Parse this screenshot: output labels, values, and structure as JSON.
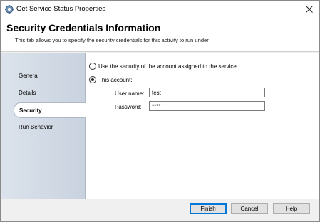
{
  "window": {
    "title": "Get Service Status Properties"
  },
  "header": {
    "title": "Security Credentials Information",
    "subtitle": "This tab allows you to specify the security credentials for this activity to run under"
  },
  "nav": {
    "items": [
      {
        "label": "General",
        "selected": false
      },
      {
        "label": "Details",
        "selected": false
      },
      {
        "label": "Security",
        "selected": true
      },
      {
        "label": "Run Behavior",
        "selected": false
      }
    ]
  },
  "content": {
    "option_service_account": "Use the security of the account assigned to the service",
    "option_this_account": "This account:",
    "selected_option": "this_account",
    "username_label": "User name:",
    "username_value": "test",
    "password_label": "Password:",
    "password_value": "****"
  },
  "buttons": {
    "finish": "Finish",
    "cancel": "Cancel",
    "help": "Help"
  },
  "icons": {
    "app": "gear-wheel-icon",
    "close": "close-icon"
  },
  "colors": {
    "nav_gradient_start": "#dce3ec",
    "nav_gradient_end": "#c9d2df",
    "default_button_border": "#0078d7"
  }
}
